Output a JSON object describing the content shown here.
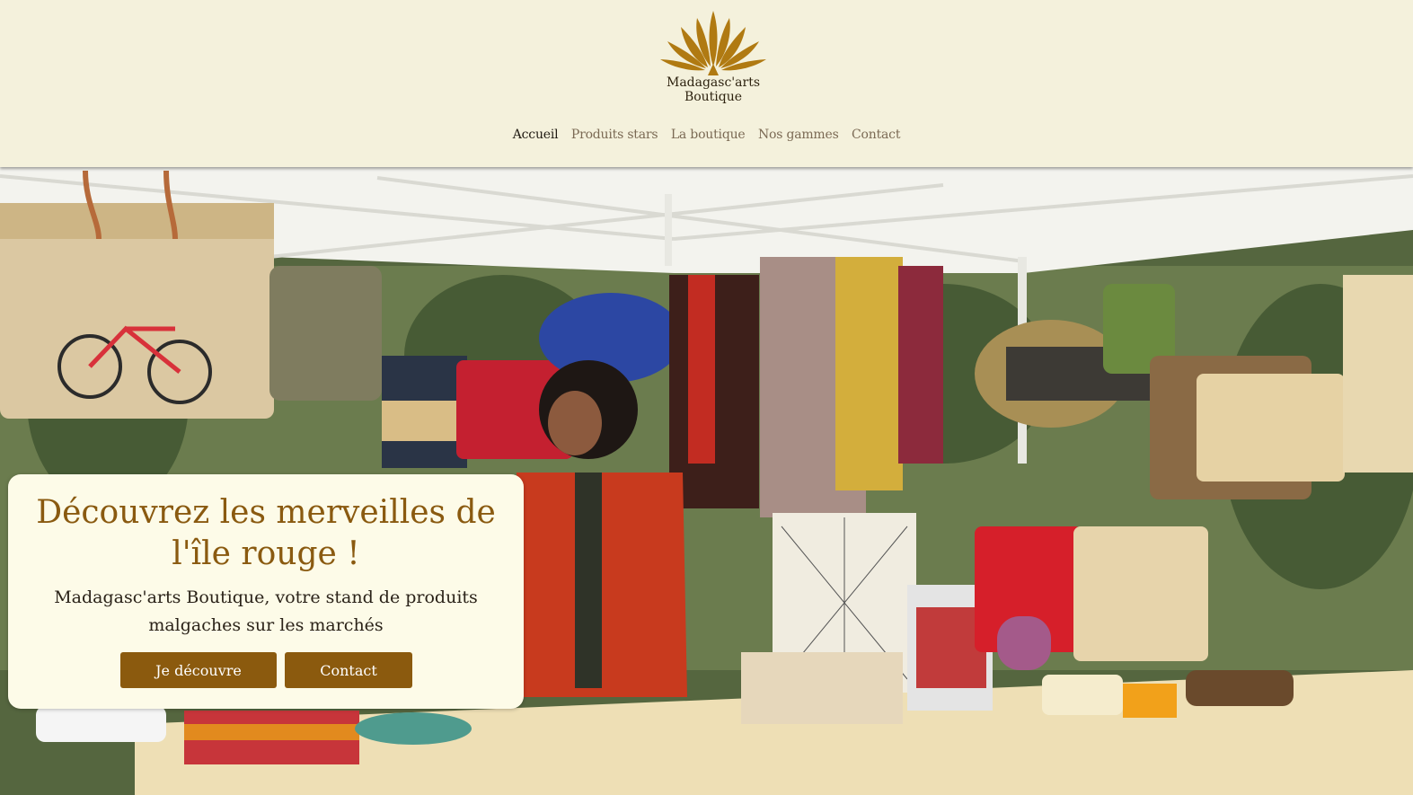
{
  "brand": {
    "name_line1": "Madagasc'arts",
    "name_line2": "Boutique",
    "logo_icon": "lotus-leaves-logo",
    "color": "#8b5a0e"
  },
  "nav": {
    "items": [
      {
        "label": "Accueil",
        "active": true
      },
      {
        "label": "Produits stars",
        "active": false
      },
      {
        "label": "La boutique",
        "active": false
      },
      {
        "label": "Nos gammes",
        "active": false
      },
      {
        "label": "Contact",
        "active": false
      }
    ]
  },
  "hero": {
    "image_alt": "",
    "title": "Découvrez les merveilles de l'île rouge !",
    "subtitle": "Madagasc'arts Boutique, votre stand de produits malgaches sur les marchés",
    "buttons": {
      "discover": "Je découvre",
      "contact": "Contact"
    }
  },
  "colors": {
    "accent": "#8b5a0e",
    "title": "#8a5a10",
    "header_bg": "#f4f1dc",
    "card_bg": "#fdfbe8"
  }
}
